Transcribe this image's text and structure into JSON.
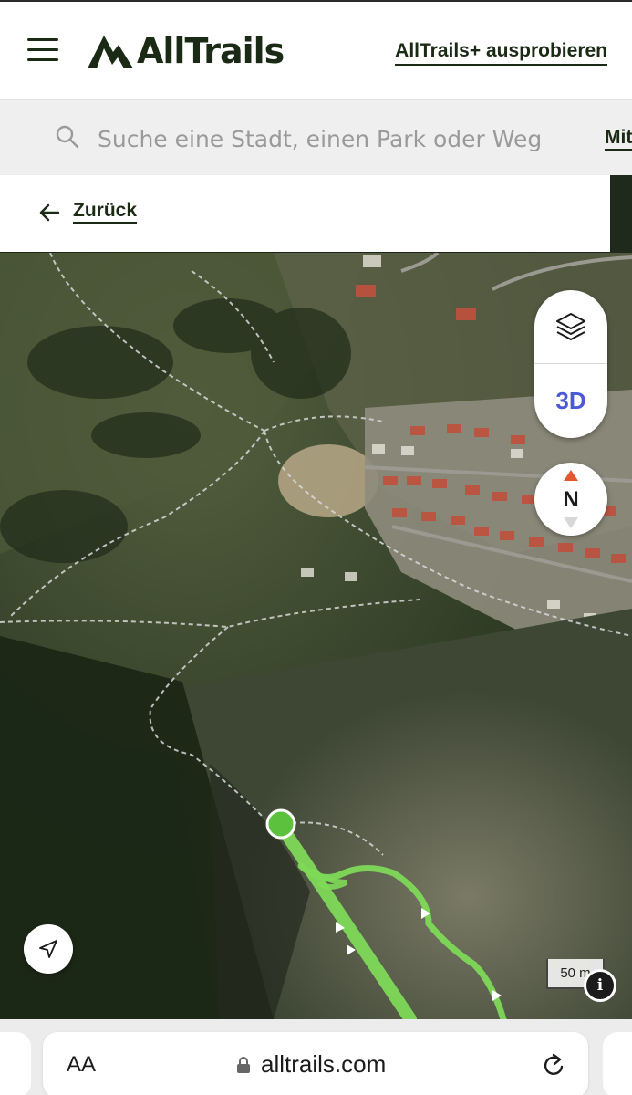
{
  "header": {
    "logo_text": "AllTrails",
    "try_plus_label": "AllTrails+ ausprobieren",
    "menu_icon": "hamburger-menu-icon",
    "logo_icon": "alltrails-mountain-logo-icon"
  },
  "search": {
    "placeholder": "Suche eine Stadt, einen Park oder Weg",
    "near_me_label": "Mit",
    "icon": "search-icon"
  },
  "back": {
    "label": "Zurück",
    "icon": "arrow-left-icon"
  },
  "map": {
    "controls": {
      "layers_icon": "layers-icon",
      "three_d_label": "3D",
      "compass_label": "N"
    },
    "scale_label": "50 m",
    "info_label": "i",
    "locate_icon": "navigation-arrow-icon",
    "trail_color": "#7ed957",
    "start_marker_color": "#5cc23d"
  },
  "browser": {
    "text_size_label": "AA",
    "url": "alltrails.com",
    "lock_icon": "lock-icon",
    "reload_icon": "reload-icon"
  }
}
